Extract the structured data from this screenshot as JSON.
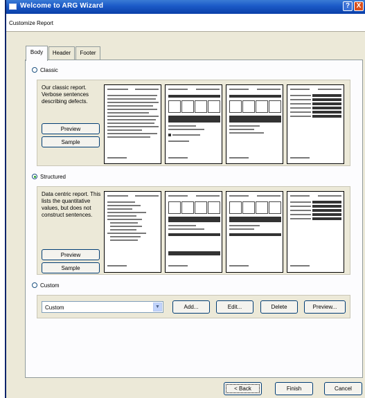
{
  "window": {
    "title": "Welcome to ARG Wizard",
    "help_label": "?",
    "close_label": "X"
  },
  "subheader": {
    "label": "Customize Report"
  },
  "tabs": [
    {
      "label": "Body",
      "active": true
    },
    {
      "label": "Header",
      "active": false
    },
    {
      "label": "Footer",
      "active": false
    }
  ],
  "options": {
    "classic": {
      "label": "Classic",
      "selected": false,
      "description": "Our classic report. Verbose sentences describing defects.",
      "preview_label": "Preview",
      "sample_label": "Sample"
    },
    "structured": {
      "label": "Structured",
      "selected": true,
      "description": "Data centric report. This lists the quantitative values, but does not construct sentences.",
      "preview_label": "Preview",
      "sample_label": "Sample"
    },
    "custom": {
      "label": "Custom",
      "selected": false,
      "select_value": "Custom",
      "add_label": "Add...",
      "edit_label": "Edit...",
      "delete_label": "Delete",
      "preview_label": "Preview..."
    }
  },
  "footer": {
    "back_label": "< Back",
    "finish_label": "Finish",
    "cancel_label": "Cancel"
  },
  "colors": {
    "titlebar": "#0a3fa8",
    "dialog_bg": "#ece9d8",
    "radio_dot": "#21a121",
    "close_button": "#d9501e"
  }
}
